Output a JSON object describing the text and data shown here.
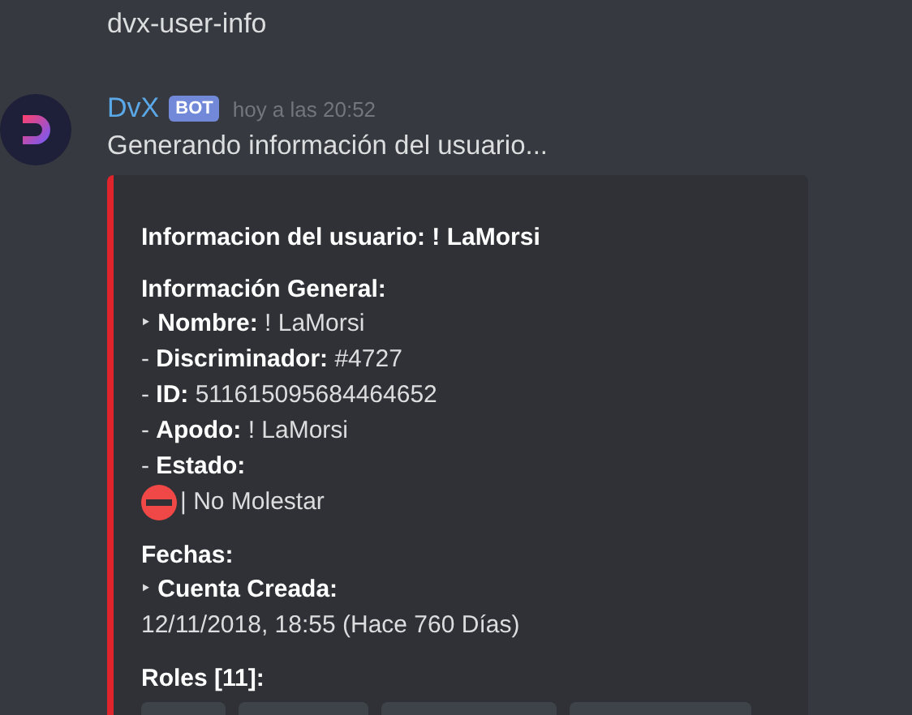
{
  "channel_header": {
    "text": "dvx-user-info"
  },
  "message": {
    "author": "DvX",
    "badge": "BOT",
    "timestamp": "hoy a las 20:52",
    "text": "Generando información del usuario...",
    "embed": {
      "color": "#e0242b",
      "title": "Informacion del usuario: ! LaMorsi",
      "sections": [
        {
          "heading": "Información General:",
          "lines": [
            {
              "kind": "text",
              "text": "‣ **Nombre:** ! LaMorsi"
            },
            {
              "kind": "text",
              "text": "- **Discriminador:** #4727"
            },
            {
              "kind": "text",
              "text": "- **ID:** 511615095684464652"
            },
            {
              "kind": "text",
              "text": "- **Apodo:** ! LaMorsi"
            },
            {
              "kind": "text",
              "text": "- **Estado:**"
            },
            {
              "kind": "status",
              "color": "#f04747",
              "text": "| No Molestar"
            }
          ]
        },
        {
          "heading": "Fechas:",
          "lines": [
            {
              "kind": "text",
              "text": "‣ **Cuenta Creada:**"
            },
            {
              "kind": "text",
              "text": "12/11/2018, 18:55 (Hace 760 Días)"
            }
          ]
        },
        {
          "heading": "Roles [11]:",
          "lines": [
            {
              "kind": "roles",
              "roles": [
                {
                  "kind": "pill"
                },
                {
                  "kind": "pill"
                },
                {
                  "kind": "pill"
                },
                {
                  "kind": "pill"
                }
              ]
            }
          ]
        }
      ]
    }
  }
}
